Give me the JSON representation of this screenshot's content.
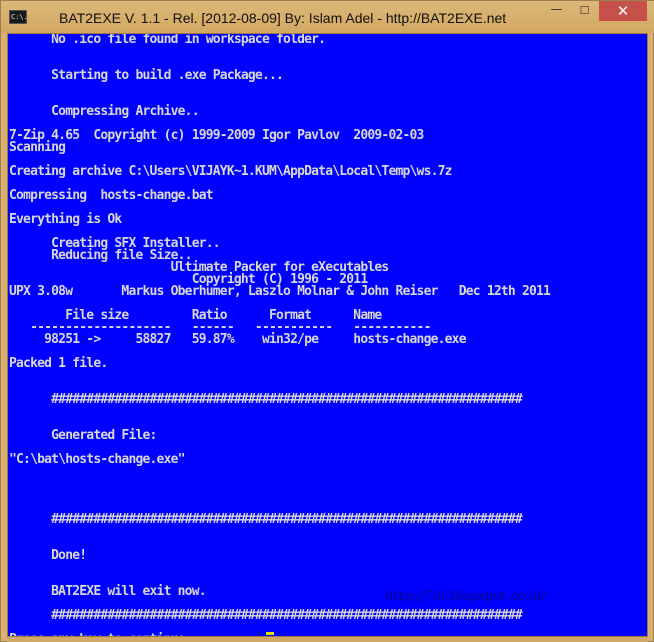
{
  "window": {
    "title": "BAT2EXE V. 1.1 - Rel. [2012-08-09] By: Islam Adel - http://BAT2EXE.net",
    "app_icon_text": "C:\\.",
    "minimize_glyph": "—",
    "maximize_glyph": "☐",
    "close_glyph": "✕"
  },
  "console": {
    "lines": [
      "      No .ico file found in workspace folder.",
      "",
      "",
      "      Starting to build .exe Package...",
      "",
      "",
      "      Compressing Archive..",
      "",
      "7-Zip 4.65  Copyright (c) 1999-2009 Igor Pavlov  2009-02-03",
      "Scanning",
      "",
      "Creating archive C:\\Users\\VIJAYK~1.KUM\\AppData\\Local\\Temp\\ws.7z",
      "",
      "Compressing  hosts-change.bat",
      "",
      "Everything is Ok",
      "",
      "      Creating SFX Installer..",
      "      Reducing file Size..",
      "                       Ultimate Packer for eXecutables",
      "                          Copyright (C) 1996 - 2011",
      "UPX 3.08w       Markus Oberhumer, Laszlo Molnar & John Reiser   Dec 12th 2011",
      "",
      "        File size         Ratio      Format      Name",
      "   --------------------   ------   -----------   -----------",
      "     98251 ->     58827   59.87%    win32/pe     hosts-change.exe",
      "",
      "Packed 1 file.",
      "",
      "",
      "      ###################################################################",
      "",
      "",
      "      Generated File:",
      "",
      "\"C:\\bat\\hosts-change.exe\"",
      "",
      "",
      "",
      "",
      "      ###################################################################",
      "",
      "",
      "      Done!",
      "",
      "",
      "      BAT2EXE will exit now.",
      "",
      "      ###################################################################",
      "",
      "Press any key to continue . . . "
    ]
  },
  "watermark": "http://7oi.blogspot.co.id/",
  "colors": {
    "console_background": "#0000ff",
    "console_text": "#d8d8d8",
    "cursor": "#e0e000",
    "close_button": "#c7504a",
    "frame": "#d8b070"
  }
}
